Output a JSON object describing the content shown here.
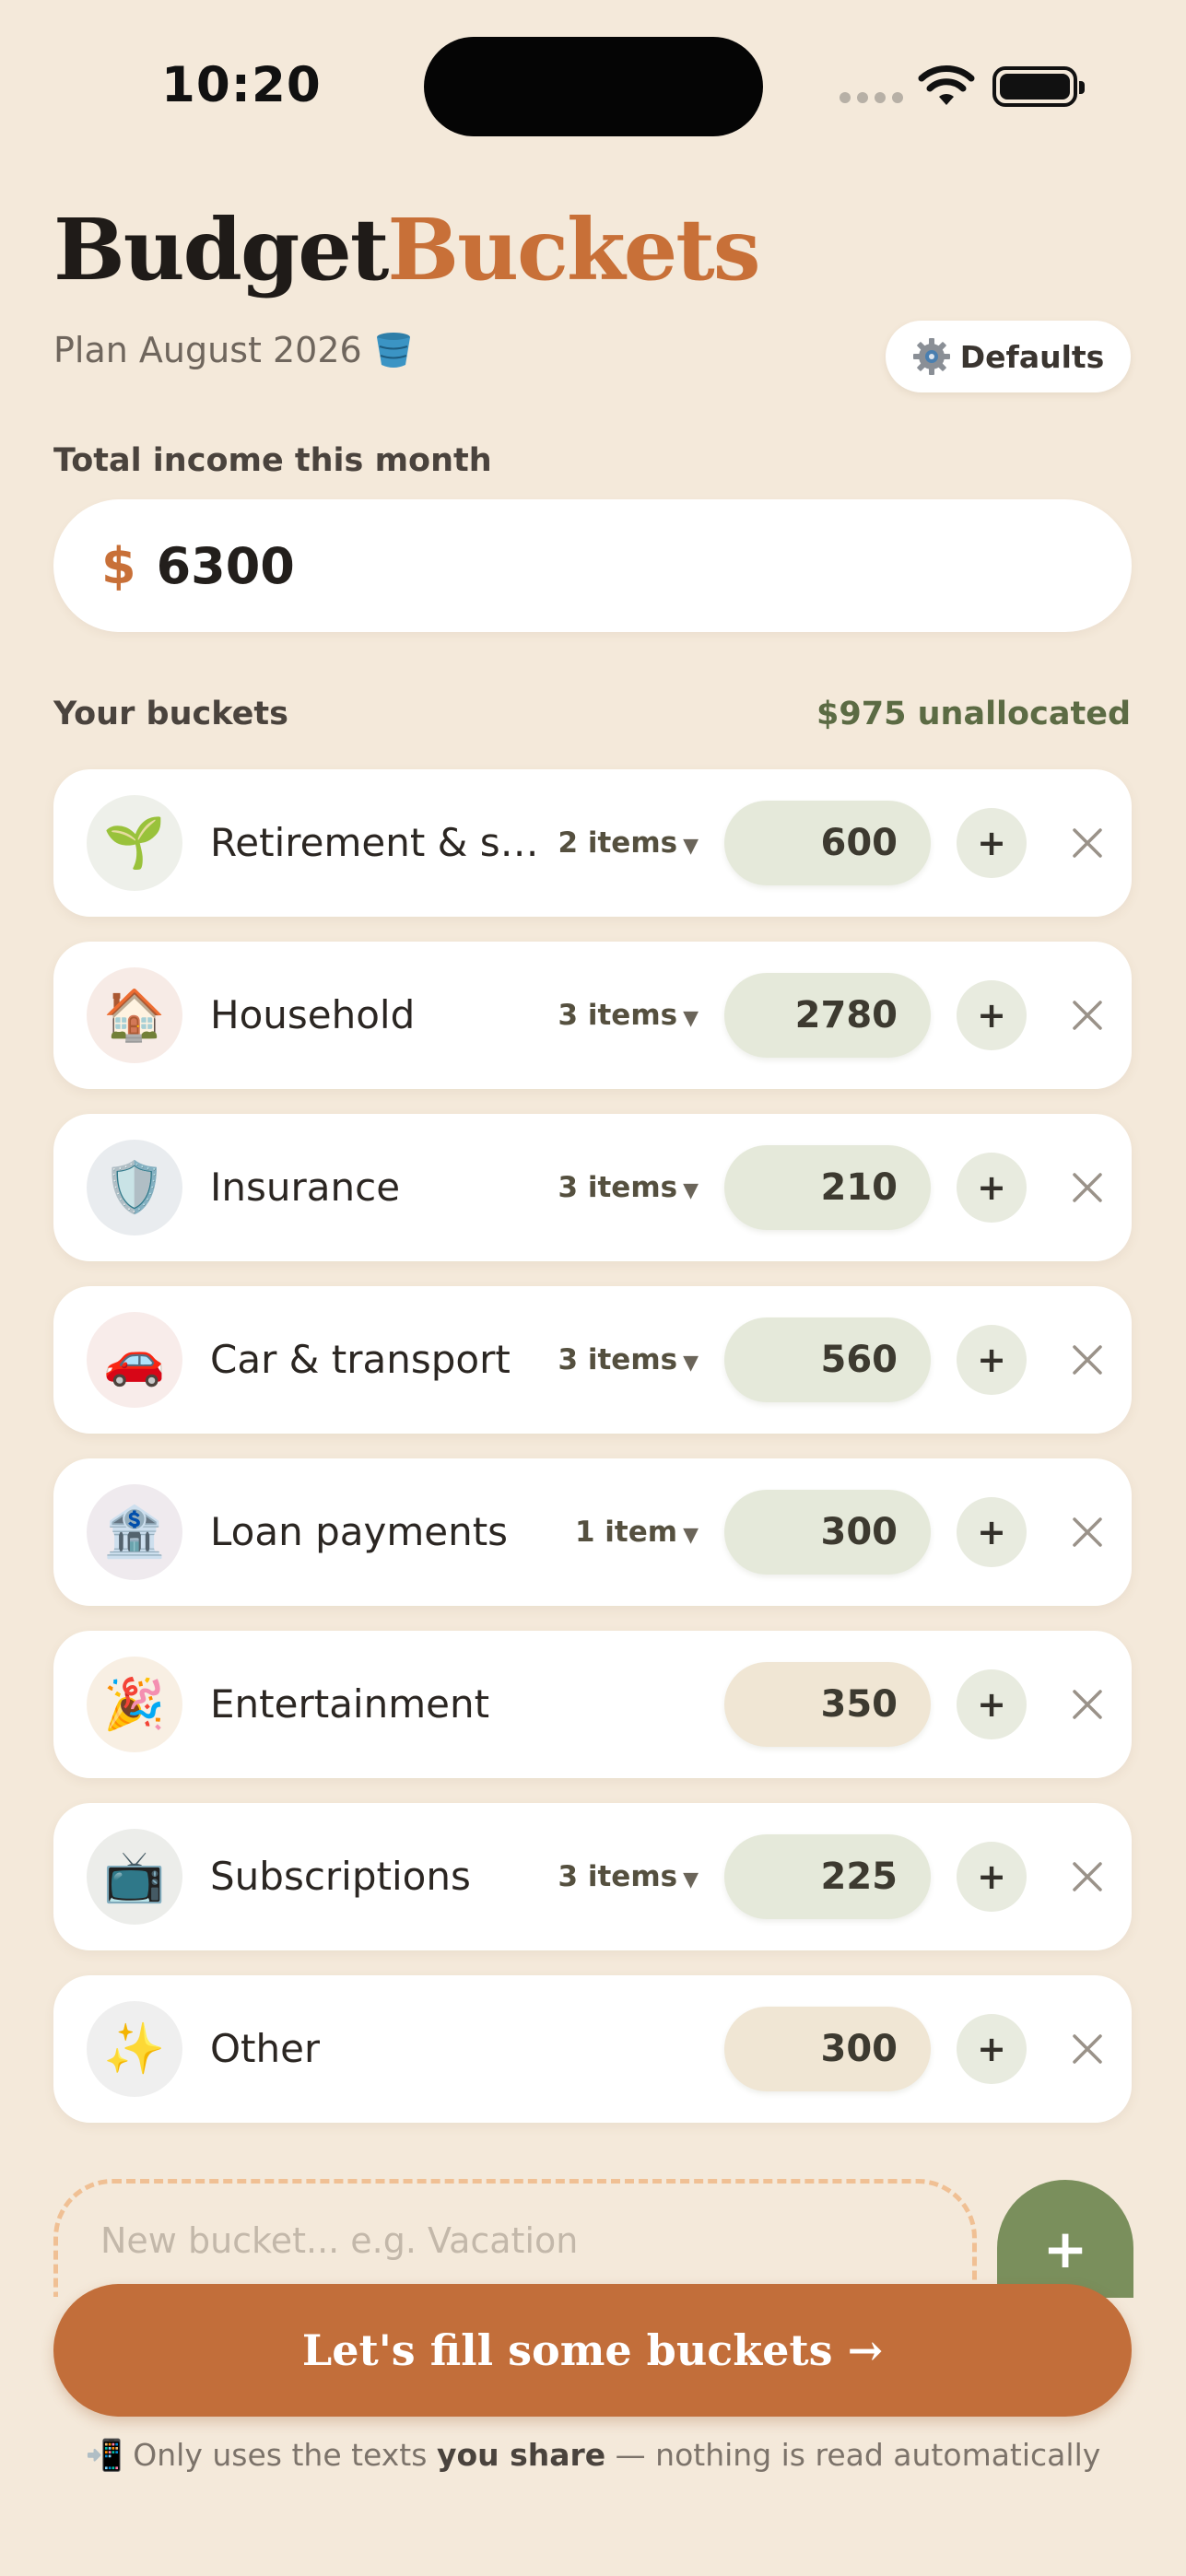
{
  "status_bar": {
    "time": "10:20"
  },
  "header": {
    "title_part1": "Budget",
    "title_part2": "Buckets",
    "subtitle": "Plan August 2026",
    "defaults_label": "Defaults"
  },
  "income": {
    "label": "Total income this month",
    "currency": "$",
    "value": "6300"
  },
  "buckets_section": {
    "label": "Your buckets",
    "unallocated": "$975 unallocated"
  },
  "buckets": [
    {
      "icon": "🌱",
      "name": "Retirement & sav...",
      "items": "2 items",
      "amount": "600",
      "style": "green",
      "avatar_bg": "#eef0ea"
    },
    {
      "icon": "🏠",
      "name": "Household",
      "items": "3 items",
      "amount": "2780",
      "style": "green",
      "avatar_bg": "#f7ebe6"
    },
    {
      "icon": "🛡️",
      "name": "Insurance",
      "items": "3 items",
      "amount": "210",
      "style": "green",
      "avatar_bg": "#e9ecef"
    },
    {
      "icon": "🚗",
      "name": "Car & transport",
      "items": "3 items",
      "amount": "560",
      "style": "green",
      "avatar_bg": "#f8ecea"
    },
    {
      "icon": "🏦",
      "name": "Loan payments",
      "items": "1 item",
      "amount": "300",
      "style": "green",
      "avatar_bg": "#efeaee"
    },
    {
      "icon": "🎉",
      "name": "Entertainment",
      "items": "",
      "amount": "350",
      "style": "tan",
      "avatar_bg": "#f8efe3"
    },
    {
      "icon": "📺",
      "name": "Subscriptions",
      "items": "3 items",
      "amount": "225",
      "style": "green",
      "avatar_bg": "#ecedea"
    },
    {
      "icon": "✨",
      "name": "Other",
      "items": "",
      "amount": "300",
      "style": "tan",
      "avatar_bg": "#efefef"
    }
  ],
  "new_bucket": {
    "placeholder": "New bucket... e.g. Vacation",
    "add_label": "+"
  },
  "cta": {
    "label": "Let's fill some buckets →"
  },
  "footnote": {
    "icon": "📲",
    "before": "Only uses the texts",
    "bold": "you share",
    "after": "— nothing is read automatically"
  },
  "colors": {
    "background": "#f4e9da",
    "accent": "#c87038",
    "green": "#7a8f5c"
  }
}
